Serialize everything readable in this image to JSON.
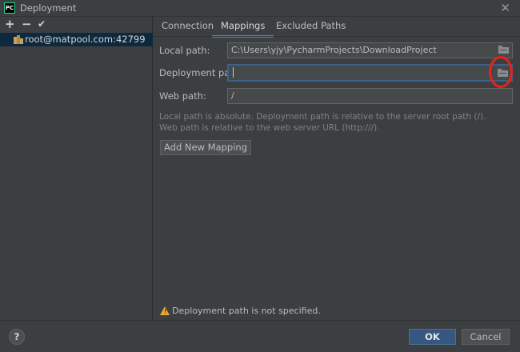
{
  "window": {
    "title": "Deployment",
    "app_icon_text": "PC",
    "close_glyph": "✕"
  },
  "sidebar": {
    "toolbar": {
      "add": "+",
      "remove": "−",
      "apply": "✔"
    },
    "servers": [
      {
        "label": "root@matpool.com:42799",
        "icon": "sftp-server-icon",
        "selected": true
      }
    ]
  },
  "tabs": [
    {
      "label": "Connection",
      "active": false
    },
    {
      "label": "Mappings",
      "active": true
    },
    {
      "label": "Excluded Paths",
      "active": false
    }
  ],
  "mappings": {
    "local_path_label": "Local path:",
    "local_path_value": "C:\\Users\\yjy\\PycharmProjects\\DownloadProject",
    "deployment_path_label": "Deployment path:",
    "deployment_path_value": "",
    "web_path_label": "Web path:",
    "web_path_value": "/",
    "help_line1": "Local path is absolute. Deployment path is relative to the server root path (/).",
    "help_line2": "Web path is relative to the web server URL (http:///).",
    "add_mapping_label": "Add New Mapping"
  },
  "status": {
    "warning_text": "Deployment path is not specified.",
    "warning_icon": "warning-icon"
  },
  "footer": {
    "help_label": "?",
    "ok_label": "OK",
    "cancel_label": "Cancel"
  },
  "colors": {
    "background": "#3c3f41",
    "selection": "#0d293e",
    "accent_tab": "#4a88c7",
    "ok_button": "#365880",
    "annotation": "#e8211a"
  }
}
